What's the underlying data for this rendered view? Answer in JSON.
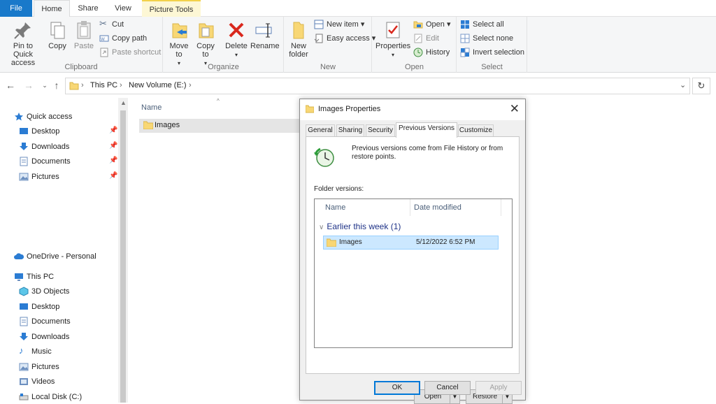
{
  "ribbon_tabs": {
    "file": "File",
    "home": "Home",
    "share": "Share",
    "view": "View",
    "picture_tools": "Picture Tools"
  },
  "clipboard": {
    "label": "Clipboard",
    "pin": "Pin to Quick access",
    "copy": "Copy",
    "paste": "Paste",
    "cut": "Cut",
    "copy_path": "Copy path",
    "paste_shortcut": "Paste shortcut"
  },
  "organize": {
    "label": "Organize",
    "move_to": "Move to",
    "copy_to": "Copy to",
    "delete": "Delete",
    "rename": "Rename"
  },
  "new_group": {
    "label": "New",
    "new_folder": "New folder",
    "new_item": "New item",
    "easy_access": "Easy access"
  },
  "open_group": {
    "label": "Open",
    "properties": "Properties",
    "open": "Open",
    "edit": "Edit",
    "history": "History"
  },
  "select_group": {
    "label": "Select",
    "select_all": "Select all",
    "select_none": "Select none",
    "invert": "Invert selection"
  },
  "address": {
    "crumbs": [
      "This PC",
      "New Volume (E:)"
    ]
  },
  "nav": {
    "quick_access": "Quick access",
    "quick_items": [
      "Desktop",
      "Downloads",
      "Documents",
      "Pictures"
    ],
    "onedrive": "OneDrive - Personal",
    "this_pc": "This PC",
    "pc_items": [
      "3D Objects",
      "Desktop",
      "Documents",
      "Downloads",
      "Music",
      "Pictures",
      "Videos",
      "Local Disk (C:)"
    ]
  },
  "content": {
    "column_name": "Name",
    "items": [
      "Images"
    ]
  },
  "dialog": {
    "title": "Images Properties",
    "tabs": [
      "General",
      "Sharing",
      "Security",
      "Previous Versions",
      "Customize"
    ],
    "info": "Previous versions come from File History or from restore points.",
    "folder_versions_label": "Folder versions:",
    "col_name": "Name",
    "col_date": "Date modified",
    "group": "Earlier this week (1)",
    "row_name": "Images",
    "row_date": "5/12/2022 6:52 PM",
    "open_btn": "Open",
    "restore_btn": "Restore",
    "ok": "OK",
    "cancel": "Cancel",
    "apply": "Apply"
  },
  "colors": {
    "accent": "#1979ca",
    "selection": "#cce8ff",
    "folder": "#f8d775"
  }
}
